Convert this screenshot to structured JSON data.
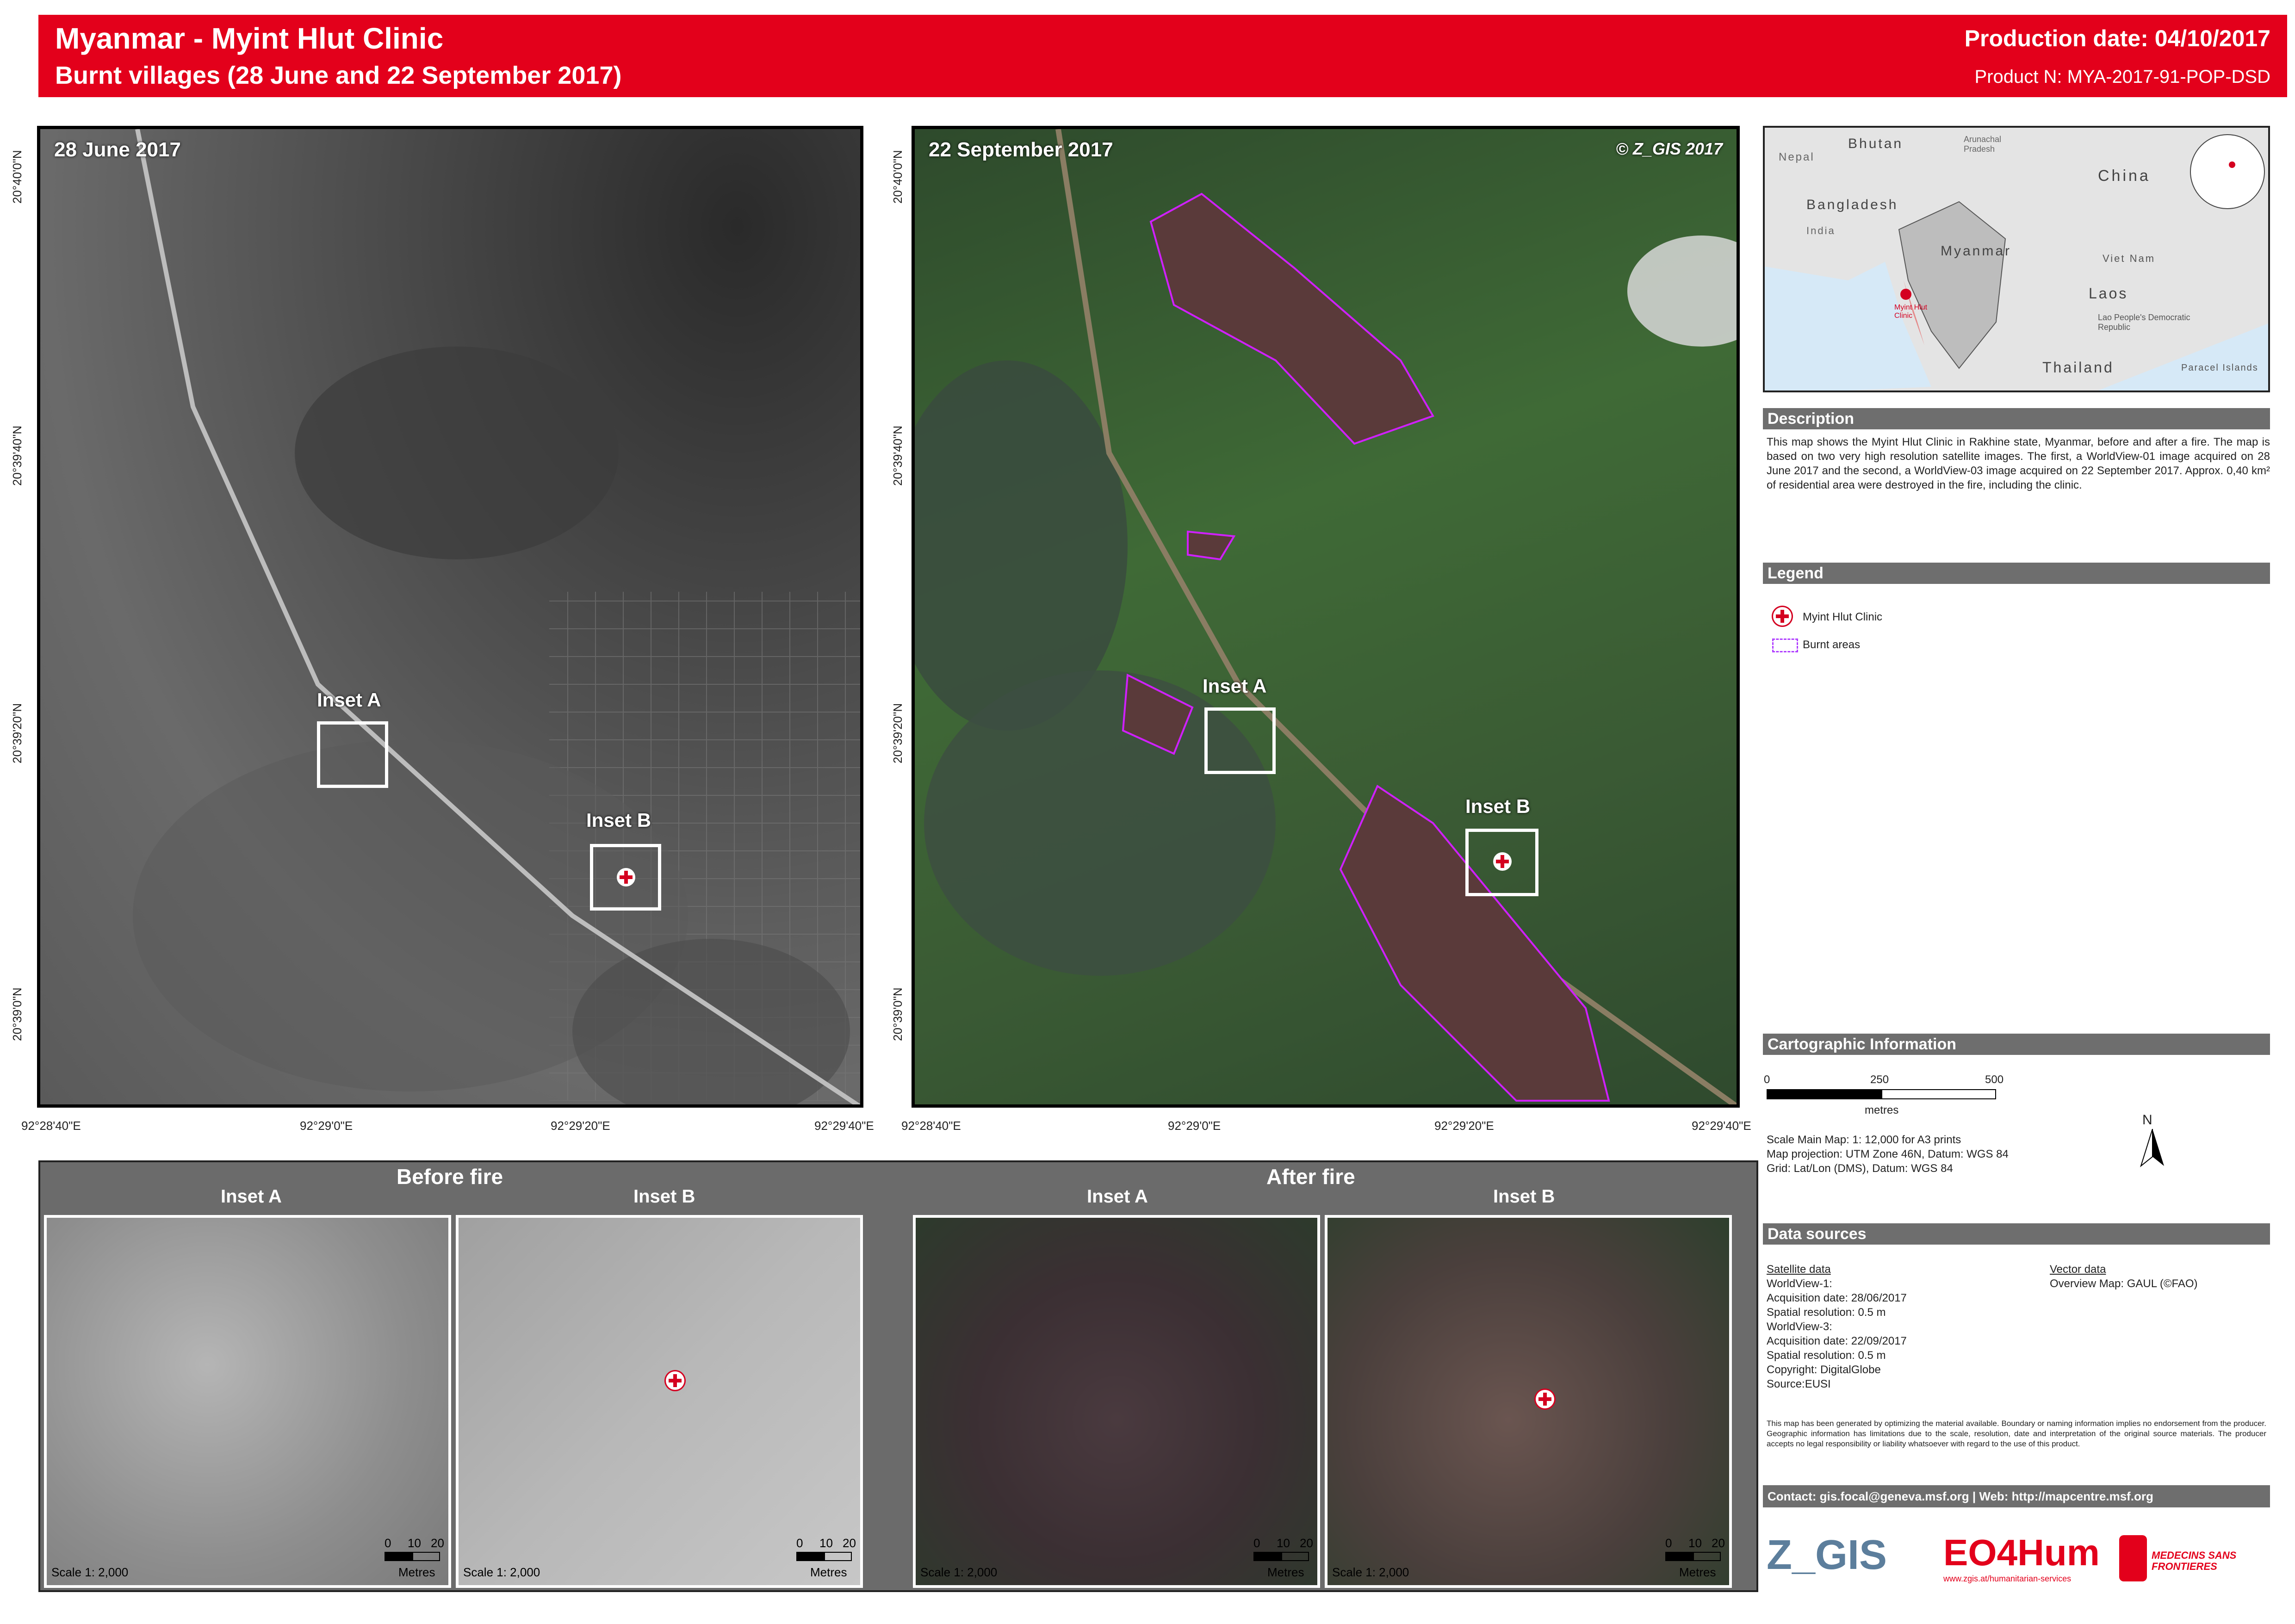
{
  "header": {
    "title": "Myanmar - Myint Hlut Clinic",
    "subtitle": "Burnt villages (28 June and 22 September 2017)",
    "production_date": "Production date: 04/10/2017",
    "product_number": "Product N: MYA-2017-91-POP-DSD"
  },
  "map_left": {
    "label": "28 June 2017",
    "inset_a": "Inset A",
    "inset_b": "Inset B"
  },
  "map_right": {
    "label": "22 September 2017",
    "copyright": "© Z_GIS 2017",
    "inset_a": "Inset A",
    "inset_b": "Inset B"
  },
  "lat_ticks": [
    "20°40'0\"N",
    "20°39'40\"N",
    "20°39'20\"N",
    "20°39'0\"N"
  ],
  "lon_ticks": [
    "92°28'40\"E",
    "92°29'0\"E",
    "92°29'20\"E",
    "92°29'40\"E"
  ],
  "overview": {
    "labels": [
      "Bhutan",
      "Arunachal Pradesh",
      "Nepal",
      "Bangladesh",
      "India",
      "China",
      "Myanmar",
      "Viet Nam",
      "Laos",
      "Lao People's Democratic Republic",
      "Thailand",
      "Paracel Islands",
      "Myint Hlut Clinic"
    ]
  },
  "description": {
    "title": "Description",
    "text": "This map shows the Myint Hlut Clinic in Rakhine state, Myanmar, before and after a fire. The map is based on two very high resolution satellite images. The first, a WorldView-01 image acquired on 28 June 2017 and the second, a WorldView-03 image acquired on 22 September 2017. Approx. 0,40 km² of residential area were destroyed in the fire, including the clinic."
  },
  "legend": {
    "title": "Legend",
    "items": [
      "Myint Hlut Clinic",
      "Burnt areas"
    ]
  },
  "cartographic": {
    "title": "Cartographic Information",
    "scale_ticks": [
      "0",
      "250",
      "500"
    ],
    "scale_unit": "metres",
    "north": "N",
    "lines": [
      "Scale Main Map: 1: 12,000 for A3 prints",
      "Map projection: UTM Zone 46N, Datum: WGS 84",
      "Grid: Lat/Lon (DMS), Datum: WGS 84"
    ]
  },
  "data_sources": {
    "title": "Data sources",
    "satellite_heading": "Satellite data",
    "satellite_lines": [
      "WorldView-1:",
      "Acquisition date: 28/06/2017",
      "Spatial resolution: 0.5 m",
      "WorldView-3:",
      "Acquisition date: 22/09/2017",
      "Spatial resolution: 0.5 m",
      "Copyright: DigitalGlobe",
      "Source:EUSI"
    ],
    "vector_heading": "Vector data",
    "vector_lines": [
      "Overview Map: GAUL (©FAO)"
    ],
    "disclaimer": "This map has been generated by optimizing the material available. Boundary or naming information implies no endorsement from the producer. Geographic information has limitations due to the scale, resolution, date and interpretation of the original source materials. The producer accepts no legal responsibility or liability whatsoever with regard to the use of this product."
  },
  "contact": "Contact: gis.focal@geneva.msf.org | Web: http://mapcentre.msf.org",
  "logos": {
    "zgis": "Z_GIS",
    "eo4hum": "EO4Hum",
    "eo4hum_url": "www.zgis.at/humanitarian-services",
    "msf": "MEDECINS SANS FRONTIERES"
  },
  "bottom": {
    "before_title": "Before fire",
    "after_title": "After fire",
    "inset_a": "Inset A",
    "inset_b": "Inset B",
    "scale_ticks": [
      "0",
      "10",
      "20"
    ],
    "scale_unit": "Metres",
    "scale_text": "Scale 1: 2,000"
  }
}
